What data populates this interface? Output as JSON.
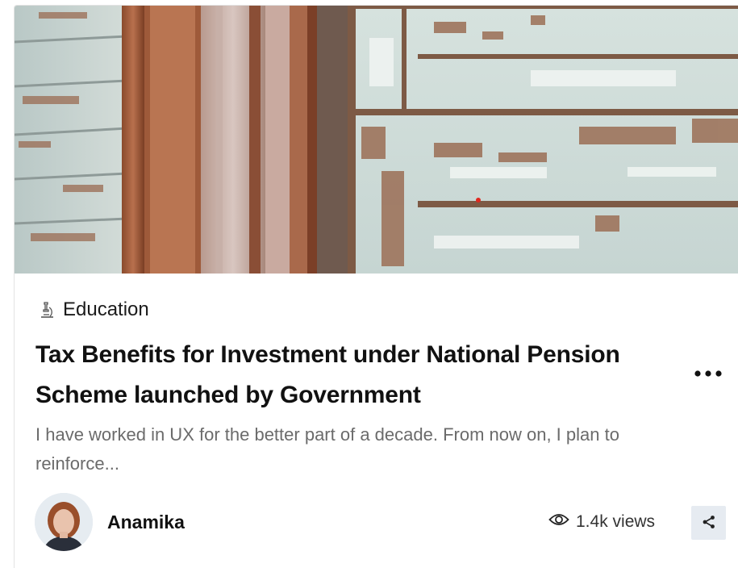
{
  "card": {
    "hero_image": "peeling-paint-window-photo",
    "category": {
      "icon": "microscope-icon",
      "label": "Education"
    },
    "title": "Tax Benefits for Investment under National Pension Scheme launched by Government",
    "excerpt": "I have worked in UX for the better part of a decade. From now on, I plan to reinforce...",
    "author": {
      "name": "Anamika",
      "avatar": "author-avatar"
    },
    "views": {
      "icon": "eye-icon",
      "label": "1.4k views"
    },
    "actions": {
      "more_icon": "more-dots-icon",
      "share_icon": "share-icon"
    }
  },
  "colors": {
    "title": "#111111",
    "excerpt": "#6b6b6b",
    "share_bg": "#e6ebf1"
  }
}
